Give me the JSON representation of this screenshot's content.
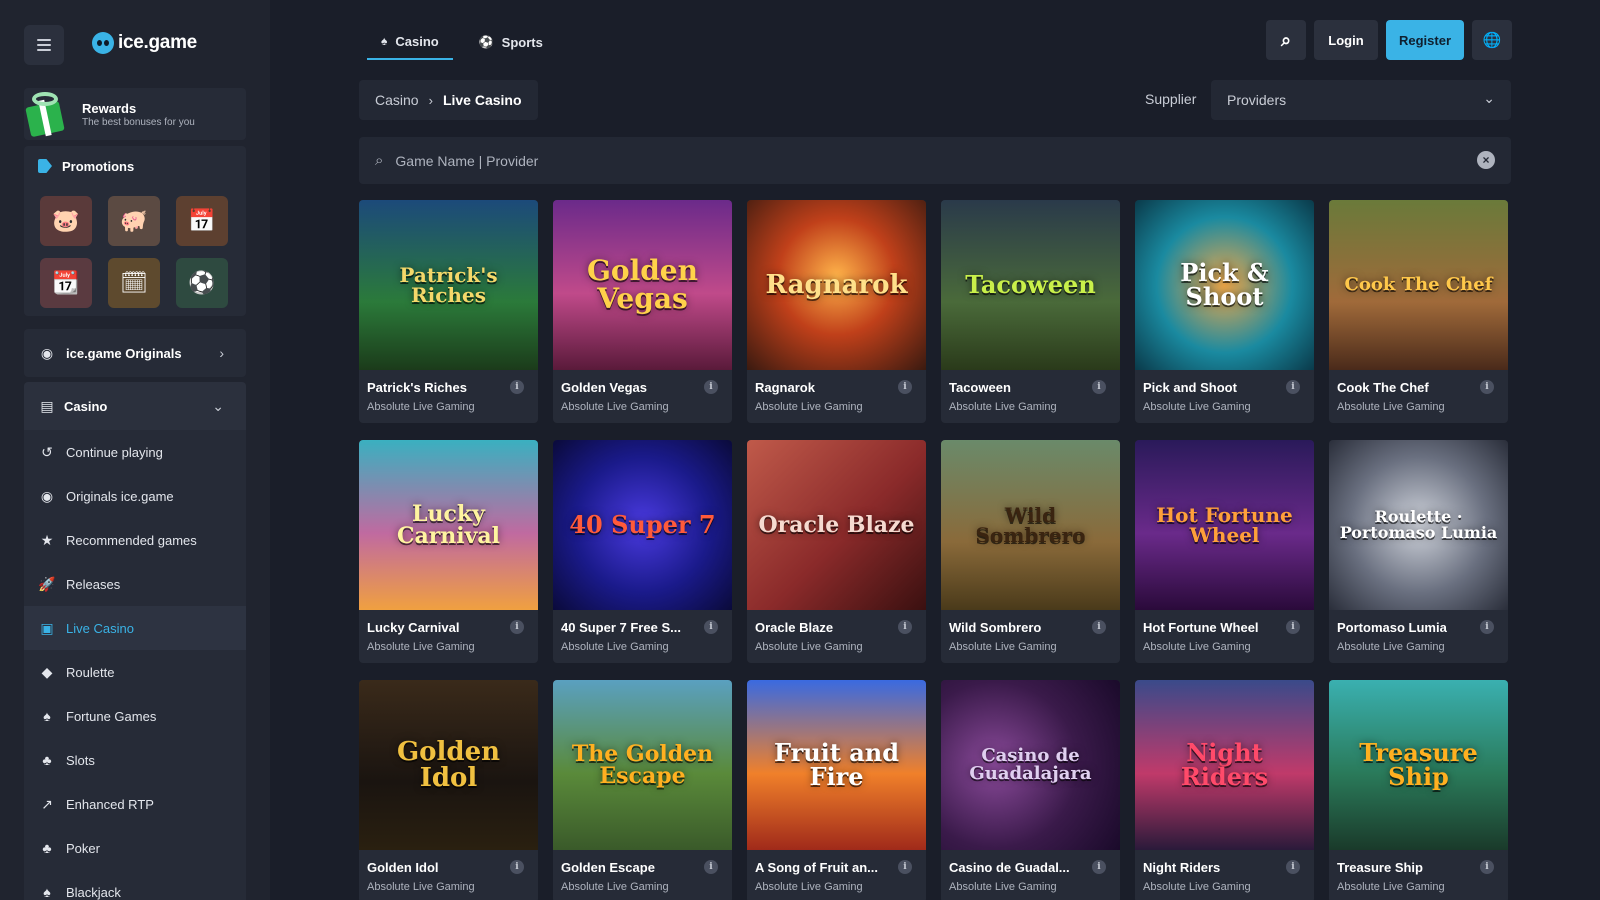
{
  "brand": {
    "name": "ice.game"
  },
  "sidebar": {
    "rewards": {
      "title": "Rewards",
      "subtitle": "The best bonuses for you"
    },
    "promotions": {
      "title": "Promotions",
      "tiles": [
        {
          "icon": "piggy-bank-icon",
          "glyph": "🐷",
          "bg": "#5a3a3a"
        },
        {
          "icon": "piggy-coin-icon",
          "glyph": "🐖",
          "bg": "#5b4a42"
        },
        {
          "icon": "calendar-coin-icon",
          "glyph": "📅",
          "bg": "#5d4030"
        },
        {
          "icon": "calendar-week-icon",
          "glyph": "📆",
          "bg": "#5a3a40"
        },
        {
          "icon": "calendar-month-icon",
          "glyph": "🗓",
          "bg": "#5e4a2e"
        },
        {
          "icon": "soccer-ball-icon",
          "glyph": "⚽",
          "bg": "#2e4a40"
        }
      ]
    },
    "originals_label": "ice.game Originals",
    "casino_label": "Casino",
    "nav": [
      {
        "label": "Continue playing",
        "glyph": "↺",
        "icon": "history-icon"
      },
      {
        "label": "Originals ice.game",
        "glyph": "◉",
        "icon": "ice-originals-icon"
      },
      {
        "label": "Recommended games",
        "glyph": "★",
        "icon": "star-icon"
      },
      {
        "label": "Releases",
        "glyph": "🚀",
        "icon": "rocket-icon"
      },
      {
        "label": "Live Casino",
        "glyph": "▣",
        "icon": "tv-icon",
        "active": true
      },
      {
        "label": "Roulette",
        "glyph": "◆",
        "icon": "roulette-icon"
      },
      {
        "label": "Fortune Games",
        "glyph": "♠",
        "icon": "fortune-icon"
      },
      {
        "label": "Slots",
        "glyph": "♣",
        "icon": "slots-icon"
      },
      {
        "label": "Enhanced RTP",
        "glyph": "↗",
        "icon": "trend-up-icon"
      },
      {
        "label": "Poker",
        "glyph": "♣",
        "icon": "poker-icon"
      },
      {
        "label": "Blackjack",
        "glyph": "♠",
        "icon": "blackjack-icon"
      }
    ]
  },
  "header": {
    "tabs": [
      {
        "label": "Casino",
        "glyph": "♠",
        "icon": "casino-icon"
      },
      {
        "label": "Sports",
        "glyph": "⚽",
        "icon": "sports-icon"
      }
    ],
    "login_label": "Login",
    "register_label": "Register"
  },
  "breadcrumb": {
    "home": "Casino",
    "current": "Live Casino"
  },
  "filter": {
    "supplier_label": "Supplier",
    "providers_value": "Providers"
  },
  "search": {
    "placeholder": "Game Name | Provider"
  },
  "colors": {
    "accent": "#3ab3e6",
    "panel": "#262b37",
    "bg": "#1a1e29"
  },
  "games": [
    {
      "title": "Patrick's Riches",
      "provider": "Absolute Live Gaming",
      "art": "Patrick's Riches",
      "bg": "linear-gradient(180deg,#1c4a7a 0%,#2b7a3a 60%,#1b3b1a 100%)",
      "fg": "#f4d86a",
      "size": 20
    },
    {
      "title": "Golden Vegas",
      "provider": "Absolute Live Gaming",
      "art": "Golden Vegas",
      "bg": "linear-gradient(180deg,#6b2a8a 0%,#c04a8a 55%,#5a1a3a 100%)",
      "fg": "#ffd24a",
      "size": 28
    },
    {
      "title": "Ragnarok",
      "provider": "Absolute Live Gaming",
      "art": "Ragnarok",
      "bg": "radial-gradient(circle at 50% 45%,#ffb34a 0%,#c0401a 45%,#3a1a10 100%)",
      "fg": "#ffe08a",
      "size": 26
    },
    {
      "title": "Tacoween",
      "provider": "Absolute Live Gaming",
      "art": "Tacoween",
      "bg": "linear-gradient(180deg,#2a3a4a 0%,#4a6a3a 60%,#2a3a1a 100%)",
      "fg": "#c9f04a",
      "size": 24
    },
    {
      "title": "Pick and Shoot",
      "provider": "Absolute Live Gaming",
      "art": "Pick & Shoot",
      "bg": "radial-gradient(circle at 50% 50%,#f0a84a 0%,#1a8aa0 55%,#0a3a4a 100%)",
      "fg": "#ffffff",
      "size": 24
    },
    {
      "title": "Cook The Chef",
      "provider": "Absolute Live Gaming",
      "art": "Cook The Chef",
      "bg": "linear-gradient(180deg,#6a7a3a 0%,#a06a3a 60%,#4a2a1a 100%)",
      "fg": "#ffc84a",
      "size": 18
    },
    {
      "title": "Lucky Carnival",
      "provider": "Absolute Live Gaming",
      "art": "Lucky Carnival",
      "bg": "linear-gradient(180deg,#3ab0c0 0%,#c06aa0 55%,#f0a040 100%)",
      "fg": "#fff4a0",
      "size": 22
    },
    {
      "title": "40 Super 7 Free S...",
      "provider": "Absolute Live Gaming",
      "art": "40 Super 7",
      "bg": "radial-gradient(circle at 50% 50%,#4a3ae0 0%,#1a1a8a 55%,#0a0a3a 100%)",
      "fg": "#ff5a3a",
      "size": 24
    },
    {
      "title": "Oracle Blaze",
      "provider": "Absolute Live Gaming",
      "art": "Oracle Blaze",
      "bg": "linear-gradient(135deg,#c05a4a 0%,#8a2a2a 55%,#3a1010 100%)",
      "fg": "#f6dad0",
      "size": 22
    },
    {
      "title": "Wild Sombrero",
      "provider": "Absolute Live Gaming",
      "art": "Wild Sombrero",
      "bg": "linear-gradient(180deg,#6a8a6a 0%,#8a6a3a 60%,#4a3a1a 100%)",
      "fg": "#3a2410",
      "size": 20
    },
    {
      "title": "Hot Fortune Wheel",
      "provider": "Absolute Live Gaming",
      "art": "Hot Fortune Wheel",
      "bg": "linear-gradient(180deg,#2a1a5a 0%,#6a2a8a 55%,#2a0a3a 100%)",
      "fg": "#ffa03a",
      "size": 20
    },
    {
      "title": "Portomaso Lumia",
      "provider": "Absolute Live Gaming",
      "art": "Roulette · Portomaso Lumia",
      "bg": "radial-gradient(circle at 50% 50%,#d0d4dc 0%,#6a7080 55%,#2a2e3a 100%)",
      "fg": "#ffffff",
      "size": 16
    },
    {
      "title": "Golden Idol",
      "provider": "Absolute Live Gaming",
      "art": "Golden Idol",
      "bg": "linear-gradient(180deg,#3a2a1a 0%,#1a1410 60%,#2a2010 100%)",
      "fg": "#f0c040",
      "size": 26
    },
    {
      "title": "Golden Escape",
      "provider": "Absolute Live Gaming",
      "art": "The Golden Escape",
      "bg": "linear-gradient(180deg,#5aa0c0 0%,#5a8a3a 55%,#3a5a2a 100%)",
      "fg": "#ffb020",
      "size": 22
    },
    {
      "title": "A Song of Fruit an...",
      "provider": "Absolute Live Gaming",
      "art": "Fruit and Fire",
      "bg": "linear-gradient(180deg,#3a6ae0 0%,#f0802a 55%,#a02a1a 100%)",
      "fg": "#ffffff",
      "size": 24
    },
    {
      "title": "Casino de Guadal...",
      "provider": "Absolute Live Gaming",
      "art": "Casino de Guadalajara",
      "bg": "radial-gradient(circle at 30% 50%,#8a4a9a 0%,#3a1a4a 55%,#1a0a2a 100%)",
      "fg": "#e0d0f0",
      "size": 18
    },
    {
      "title": "Night Riders",
      "provider": "Absolute Live Gaming",
      "art": "Night Riders",
      "bg": "linear-gradient(180deg,#3a4a8a 0%,#c03a6a 55%,#2a1a3a 100%)",
      "fg": "#ff4a6a",
      "size": 24
    },
    {
      "title": "Treasure Ship",
      "provider": "Absolute Live Gaming",
      "art": "Treasure Ship",
      "bg": "linear-gradient(180deg,#3ab0b0 0%,#2a7a5a 55%,#1a3a2a 100%)",
      "fg": "#ffb020",
      "size": 24
    }
  ]
}
